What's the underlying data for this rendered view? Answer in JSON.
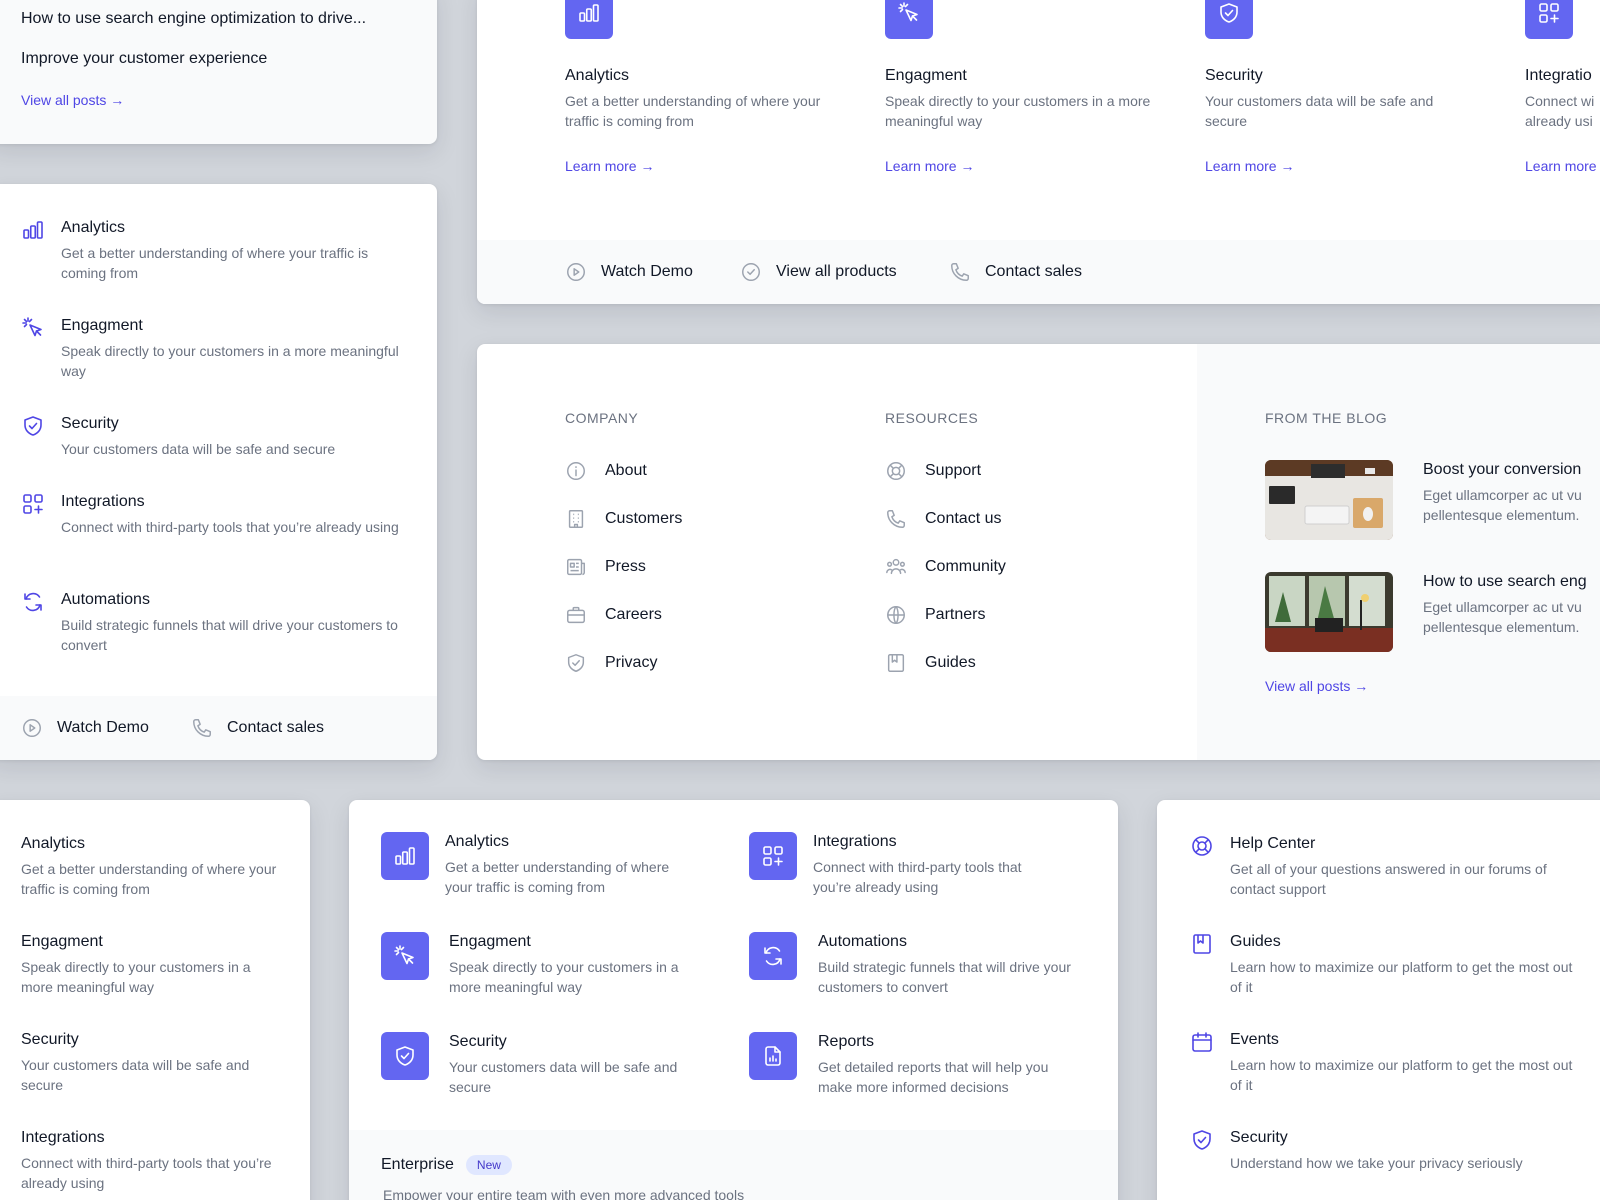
{
  "colors": {
    "accent": "#4f46e5",
    "accent_bg": "#6366f1",
    "background": "#d1d5db"
  },
  "blog_panel": {
    "posts": [
      "How to use search engine optimization to drive...",
      "Improve your customer experience"
    ],
    "view_all": "View all posts →"
  },
  "features": {
    "analytics": {
      "title": "Analytics",
      "desc": "Get a better understanding of where your traffic is coming from",
      "icon": "chart-bar-icon"
    },
    "engagement": {
      "title": "Engagment",
      "desc": "Speak directly to your customers in a more meaningful way",
      "icon": "cursor-click-icon"
    },
    "security": {
      "title": "Security",
      "desc": "Your customers data will be safe and secure",
      "icon": "shield-check-icon"
    },
    "integrations": {
      "title": "Integrations",
      "desc": "Connect with third-party tools that you’re already using",
      "icon": "squares-plus-icon"
    },
    "automations": {
      "title": "Automations",
      "desc": "Build strategic funnels that will drive your customers to convert",
      "icon": "refresh-icon"
    },
    "reports": {
      "title": "Reports",
      "desc": "Get detailed reports that will help you make more informed decisions",
      "icon": "document-chart-icon"
    }
  },
  "panel_c": {
    "integrations_title_visible": "Integratio",
    "integrations_desc_visible_1": "Connect wi",
    "integrations_desc_visible_2": "already usi",
    "learn_more": "Learn more →",
    "learn_more_cut": "Learn more"
  },
  "footer_actions": {
    "watch_demo": "Watch Demo",
    "view_all_products": "View all products",
    "contact_sales": "Contact sales"
  },
  "panel_d": {
    "company_heading": "COMPANY",
    "company_items": [
      "About",
      "Customers",
      "Press",
      "Careers",
      "Privacy"
    ],
    "resources_heading": "RESOURCES",
    "resources_items": [
      "Support",
      "Contact us",
      "Community",
      "Partners",
      "Guides"
    ],
    "blog_heading": "FROM THE BLOG",
    "blog_posts": [
      {
        "title": "Boost your conversion",
        "line1": "Eget ullamcorper ac ut vu",
        "line2": "pellentesque elementum."
      },
      {
        "title": "How to use search eng",
        "line1": "Eget ullamcorper ac ut vu",
        "line2": "pellentesque elementum."
      }
    ],
    "view_all": "View all posts →"
  },
  "panel_f": {
    "enterprise_title": "Enterprise",
    "enterprise_badge": "New",
    "enterprise_desc": "Empower your entire team with even more advanced tools"
  },
  "panel_g": {
    "items": [
      {
        "title": "Help Center",
        "desc": "Get all of your questions answered in our forums of contact support",
        "icon": "lifebuoy-icon"
      },
      {
        "title": "Guides",
        "desc": "Learn how to maximize our platform to get the most out of it",
        "icon": "bookmark-book-icon"
      },
      {
        "title": "Events",
        "desc": "Learn how to maximize our platform to get the most out of it",
        "icon": "calendar-icon"
      },
      {
        "title": "Security",
        "desc": "Understand how we take your privacy seriously",
        "icon": "shield-check-icon"
      }
    ]
  }
}
